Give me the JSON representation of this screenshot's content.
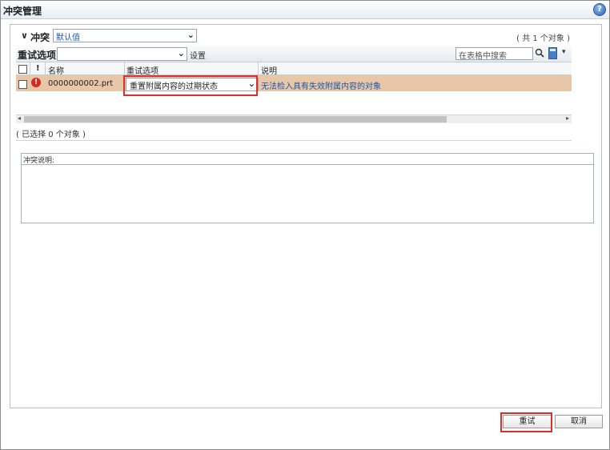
{
  "window": {
    "title": "冲突管理"
  },
  "conflict": {
    "label": "冲突",
    "filter_value": "默认值",
    "count_text": "( 共 1 个对象 )"
  },
  "toolbar": {
    "retry_options_label": "重试选项",
    "retry_select_value": "",
    "settings_label": "设置",
    "search_placeholder": "在表格中搜索"
  },
  "table": {
    "columns": [
      "!",
      "名称",
      "重试选项",
      "说明"
    ],
    "rows": [
      {
        "name": "0000000002.prt",
        "retry_option": "重置附属内容的过期状态",
        "description": "无法检入具有失效附属内容的对象"
      }
    ]
  },
  "status": {
    "selected_text": "( 已选择 0 个对象 )"
  },
  "description_panel": {
    "title": "冲突说明:"
  },
  "buttons": {
    "retry": "重试",
    "cancel": "取消"
  },
  "colors": {
    "row_highlight": "#e8c7a9",
    "link_blue": "#1a56a8",
    "annotation_red": "#d9302c"
  }
}
